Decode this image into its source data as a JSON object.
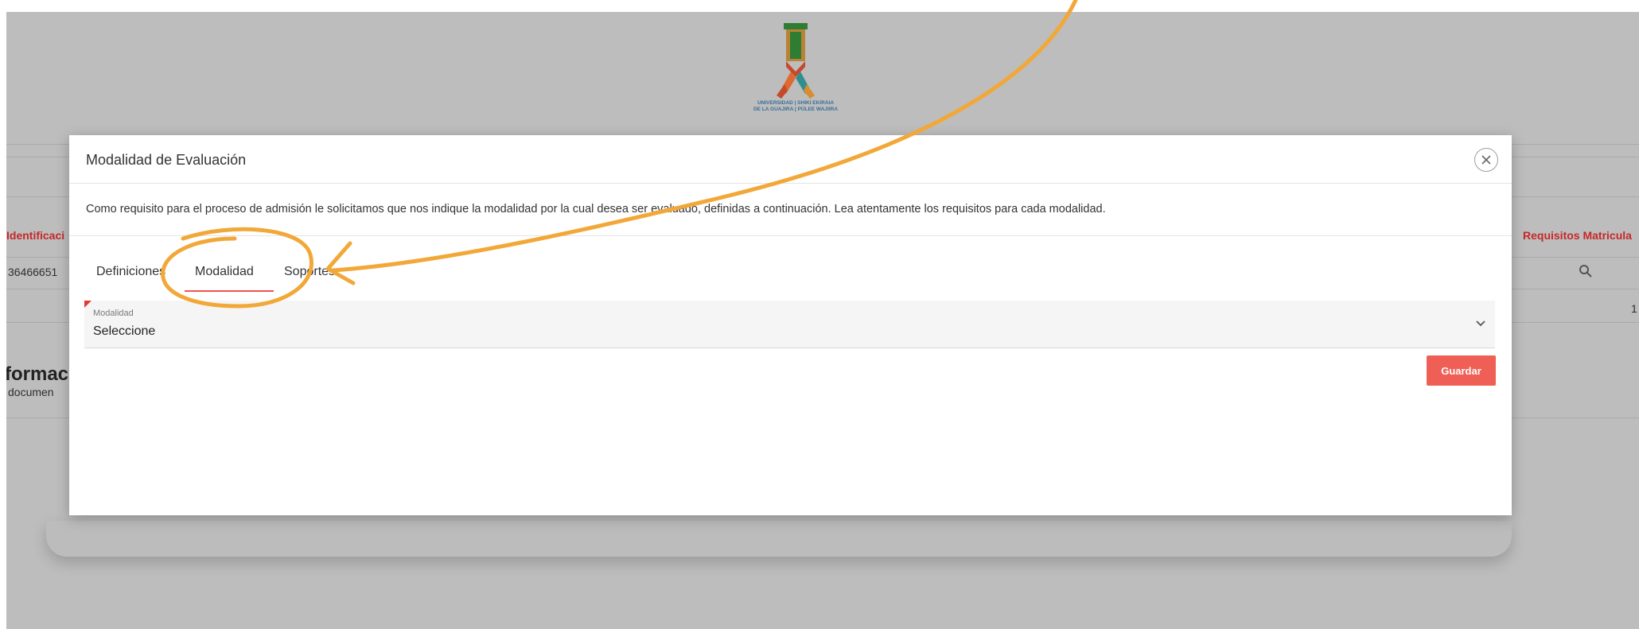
{
  "background": {
    "logo_line1": "UNIVERSIDAD | SHIKI EKIRAIA",
    "logo_line2": "DE LA GUAJIRA | PÜLEE WAJIIRA",
    "col_identificacion": "Identificaci",
    "col_requisitos": "Requisitos Matricula",
    "row_id": "36466651",
    "row_count": "1",
    "section_title": "formaci",
    "section_subtitle": "documen",
    "search_icon": "search-icon"
  },
  "modal": {
    "title": "Modalidad de Evaluación",
    "description": "Como requisito para el proceso de admisión le solicitamos que nos indique la modalidad por la cual desea ser evaluado, definidas a continuación. Lea atentamente los requisitos para cada modalidad.",
    "close_icon": "close-icon",
    "tabs": [
      {
        "label": "Definiciones"
      },
      {
        "label": "Modalidad",
        "active": true
      },
      {
        "label": "Soportes"
      }
    ],
    "select": {
      "label": "Modalidad",
      "value": "Seleccione",
      "icon": "chevron-down-icon"
    },
    "save_label": "Guardar"
  },
  "colors": {
    "accent": "#ef5350",
    "save_button": "#f05f55",
    "annotation": "#f2a838",
    "overlay": "#bdbdbd"
  }
}
